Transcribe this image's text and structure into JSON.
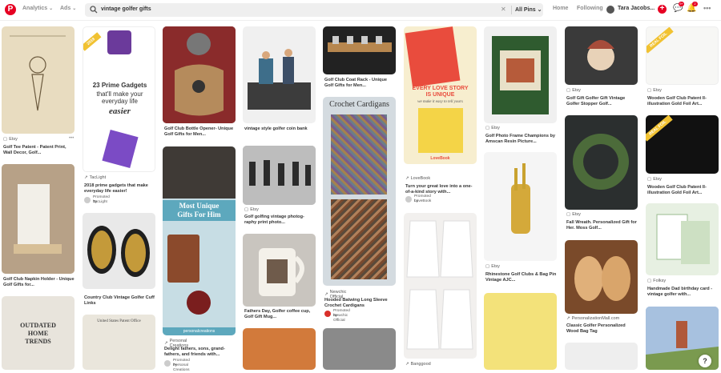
{
  "header": {
    "nav": [
      "Analytics",
      "Ads"
    ],
    "search_query": "vintage golfer gifts",
    "search_scope": "All Pins",
    "right_nav": [
      "Home",
      "Following"
    ],
    "user_name": "Tara Jacobs...",
    "notif_counts": [
      "9+",
      "2"
    ]
  },
  "pins": [
    {
      "source": "Etsy",
      "title": "Golf Tee Patent - Patent Print, Wall Decor, Golf..."
    },
    {
      "source": "",
      "title": "Golf Club Napkin Holder - Unique Golf Gifts for..."
    },
    {
      "source": "TacLight",
      "title": "2018 prime gadgets that make everyday life easier!",
      "promoted_by": "TacLight",
      "image_text": {
        "year": "2018",
        "best": "BEST SELLERS",
        "main1": "23 Prime Gadgets",
        "main2": "that'll make your",
        "main3": "everyday life",
        "main4": "easier"
      }
    },
    {
      "source": "",
      "title": "Country Club Vintage Golfer Cuff Links"
    },
    {
      "source": "",
      "title": "Golf Club Bottle Opener- Unique Golf Gifts for Men..."
    },
    {
      "source": "Personal Creations",
      "title": "Delight fathers, sons, grand- fathers, and friends with...",
      "promoted_by": "Personal Creations",
      "image_text": {
        "a": "Most Unique",
        "b": "Gifts For Him",
        "c": "personalcreations"
      }
    },
    {
      "source": "",
      "title": "vintage style golfer coin bank"
    },
    {
      "source": "Etsy",
      "title": "Golf golfing vintage photog- raphy print photo..."
    },
    {
      "source": "",
      "title": "Fathers Day, Golfer coffee cup, Golf Gift Mug..."
    },
    {
      "source": "",
      "title": "Golf Club Coat Rack - Unique Golf Gifts for Men..."
    },
    {
      "source": "Newchic Official",
      "title": "Hooded Batwing Long Sleeve Crochet Cardigans",
      "promoted_by": "Newchic Official",
      "image_text": {
        "a": "Crochet Cardigans"
      }
    },
    {
      "source": "LoveBook",
      "title": "Turn your great love into a one-of-a-kind story with...",
      "promoted_by": "LoveBook",
      "image_text": {
        "a": "EVERY LOVE STORY",
        "b": "IS UNIQUE",
        "c": "we make it easy to tell yours",
        "d": "LoveBook"
      }
    },
    {
      "source": "Banggood",
      "title": ""
    },
    {
      "source": "Etsy",
      "title": "Golf Photo Frame Champions by Amscan Resin Picture..."
    },
    {
      "source": "Etsy",
      "title": "Rhinestone Golf Clubs & Bag Pin Vintage AJC..."
    },
    {
      "source": "Etsy",
      "title": "Golf Gift Golfer Gift Vintage Golfer Stopper Golf..."
    },
    {
      "source": "Etsy",
      "title": "Fall Wreath. Personalized Gift for Her. Moss Golf..."
    },
    {
      "source": "PersonalizationMall.com",
      "title": "Classic Golfer Personalized Wood Bag Tag"
    },
    {
      "source": "Etsy",
      "title": "Wooden Golf Club Patent II- illustration Gold Foil Art...",
      "image_text": {
        "badge": "REAL FOIL"
      }
    },
    {
      "source": "Etsy",
      "title": "Wooden Golf Club Patent II- illustration Gold Foil Art...",
      "image_text": {
        "badge": "REAL FOIL"
      }
    },
    {
      "source": "Folksy",
      "title": "Handmade Dad birthday card - vintage golfer with..."
    }
  ],
  "promoted_label": "Promoted by",
  "bottom_texts": {
    "outdated": "OUTDATED",
    "home": "HOME",
    "trends": "TRENDS",
    "patent": "United States Patent Office"
  },
  "help": "?"
}
